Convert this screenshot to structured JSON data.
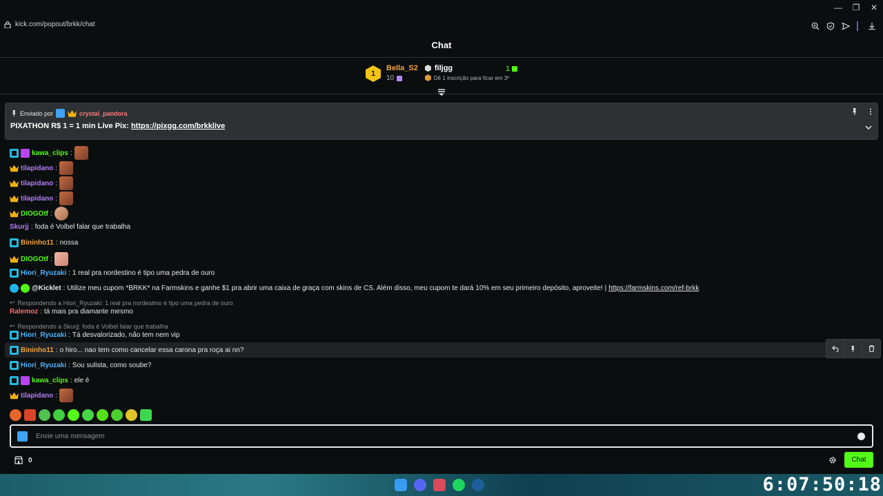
{
  "browser": {
    "url": "kick.com/popout/brkk/chat"
  },
  "header": {
    "title": "Chat"
  },
  "leaderboard": {
    "first": {
      "rank": "1",
      "name": "Bella_S2",
      "count": "10"
    },
    "second": {
      "name": "filjgg",
      "tip": "Dê 1 inscrição para ficar em 3º",
      "count": "1"
    }
  },
  "pinned": {
    "sent_by_label": "Enviado por",
    "user": "crystal_pandora",
    "text": "PIXATHON R$ 1 = 1 min Live Pix: ",
    "link": "https://pixgg.com/brkklive"
  },
  "messages": [
    {
      "user": "kawa_clips",
      "color": "#53fc18",
      "text": ""
    },
    {
      "user": "tilapidano",
      "color": "#b47cf8",
      "text": ""
    },
    {
      "user": "tilapidano",
      "color": "#b47cf8",
      "text": ""
    },
    {
      "user": "tilapidano",
      "color": "#b47cf8",
      "text": ""
    },
    {
      "user": "DIOGOtf",
      "color": "#53fc18",
      "text": ""
    },
    {
      "user": "Skurjj",
      "color": "#b47cf8",
      "text": "foda é Volbel falar que trabalha"
    },
    {
      "user": "Bininho11",
      "color": "#f2a33a",
      "text": "nossa"
    },
    {
      "user": "DIOGOtf",
      "color": "#53fc18",
      "text": ""
    },
    {
      "user": "Hiori_Ryuzaki",
      "color": "#4fb4ff",
      "text": "1 real pra nordestino é tipo uma pedra de ouro"
    },
    {
      "user": "@Kicklet",
      "color": "#e7e9ea",
      "text": "Utilize meu cupom *BRKK* na Farmskins e ganhe $1 pra abrir uma caixa de graça com skins de CS. Além disso, meu cupom te dará 10% em seu primeiro depósito, aproveite! | ",
      "link": "https://farmskins.com/ref-brkk"
    },
    {
      "reply": "Respondendo a Hiori_Ryuzaki: 1 real pra nordestino é tipo uma pedra de ouro",
      "user": "Ralemoz",
      "color": "#ff6b6b",
      "text": "tá mais pra diamante mesmo"
    },
    {
      "reply": "Respondendo a Skurjj: foda é Volbel falar que trabalha",
      "user": "Hiori_Ryuzaki",
      "color": "#4fb4ff",
      "text": "Tá desvalorizado, não tem nem vip"
    },
    {
      "user": "Bininho11",
      "color": "#f2a33a",
      "text": "o hiro... nao tem como cancelar essa carona pra roça ai nn?"
    },
    {
      "user": "Hiori_Ryuzaki",
      "color": "#4fb4ff",
      "text": "Sou sulista, como soube?"
    },
    {
      "user": "kawa_clips",
      "color": "#53fc18",
      "text": "ele é"
    },
    {
      "user": "tilapidano",
      "color": "#b47cf8",
      "text": ""
    }
  ],
  "input": {
    "placeholder": "Envie uma mensagem"
  },
  "footer": {
    "points": "0",
    "chat_button": "Chat"
  },
  "clock": "6:07:50:18",
  "colors": {
    "accent": "#53fc18",
    "background": "#0b0e0f"
  }
}
